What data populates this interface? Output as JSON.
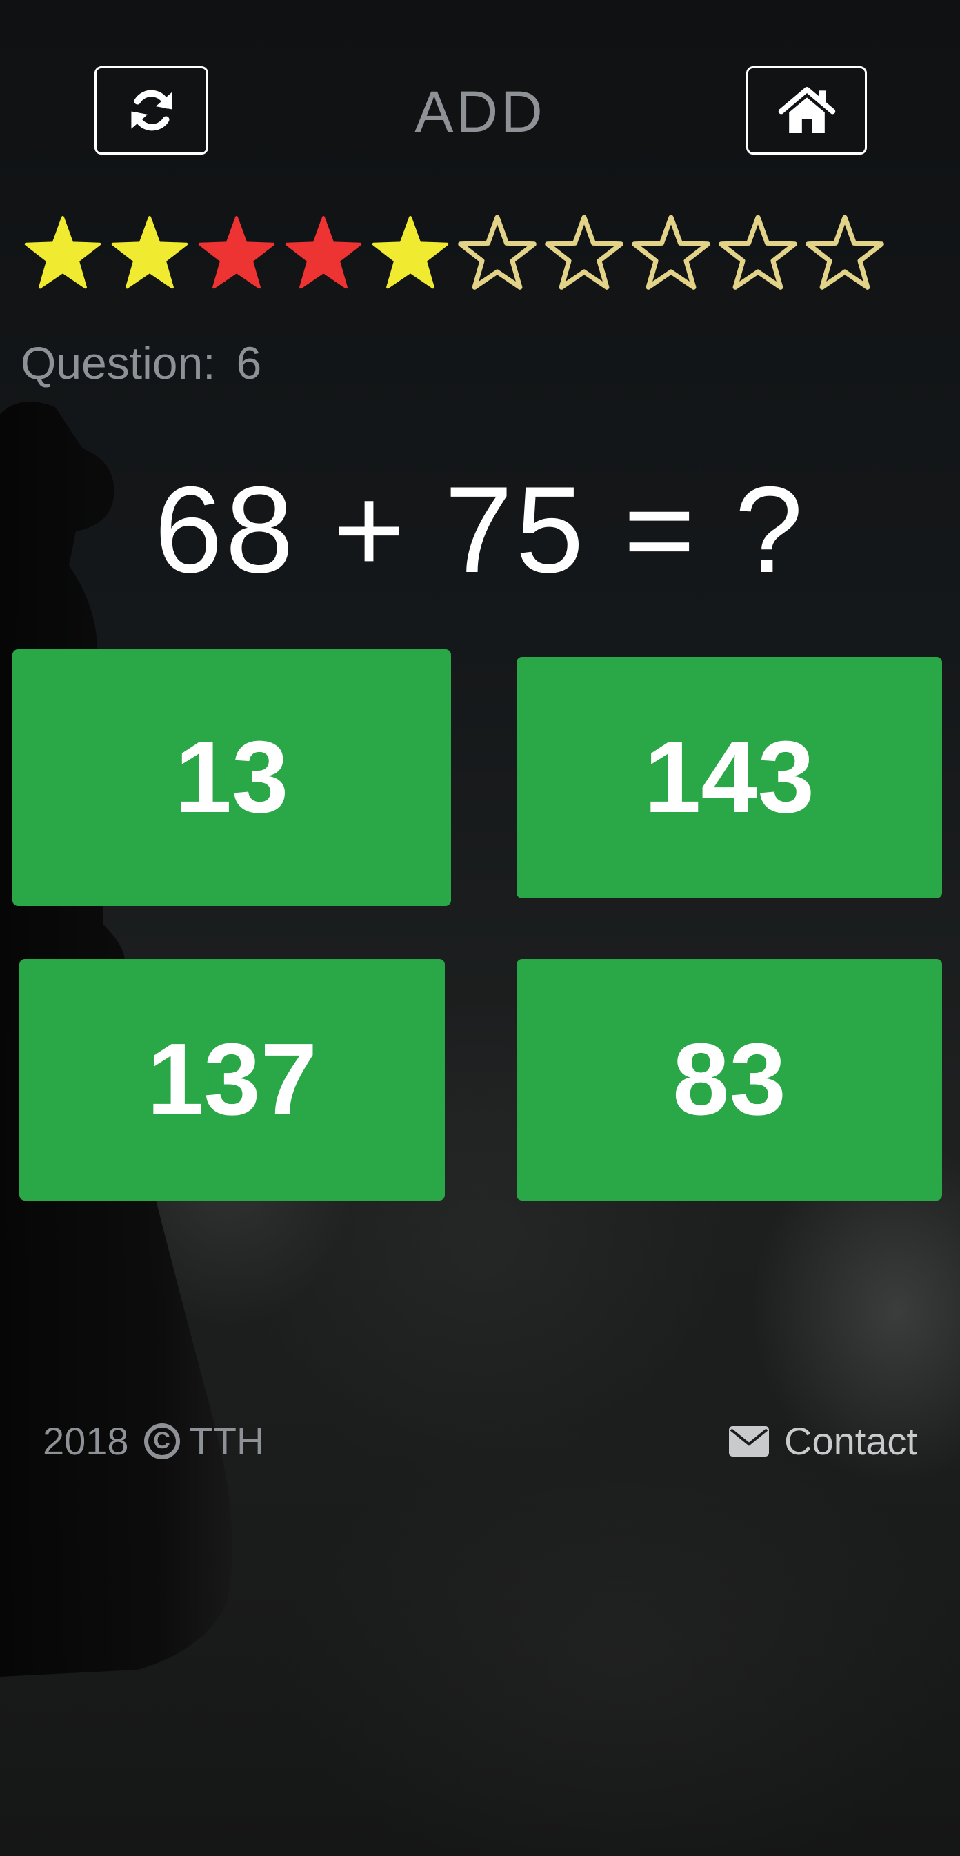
{
  "header": {
    "title": "ADD",
    "refresh_icon": "refresh-icon",
    "home_icon": "home-icon"
  },
  "progress": {
    "total": 10,
    "results": [
      "correct",
      "correct",
      "wrong",
      "wrong",
      "correct",
      "empty",
      "empty",
      "empty",
      "empty",
      "empty"
    ],
    "colors": {
      "correct": "#f0ea30",
      "wrong": "#ee3333",
      "empty_outline": "#e2d388"
    }
  },
  "question": {
    "label": "Question:",
    "number": "6",
    "equation": "68 + 75 = ?"
  },
  "answers": [
    {
      "value": "13",
      "selected": true
    },
    {
      "value": "143",
      "selected": false
    },
    {
      "value": "137",
      "selected": false
    },
    {
      "value": "83",
      "selected": false
    }
  ],
  "colors": {
    "answer_bg": "#2aa747",
    "answer_selected_bg": "#238a3a",
    "title_text": "#8e9296"
  },
  "footer": {
    "year": "2018",
    "copyright_symbol": "C",
    "owner": "TTH",
    "contact_label": "Contact",
    "contact_icon": "envelope-icon"
  }
}
